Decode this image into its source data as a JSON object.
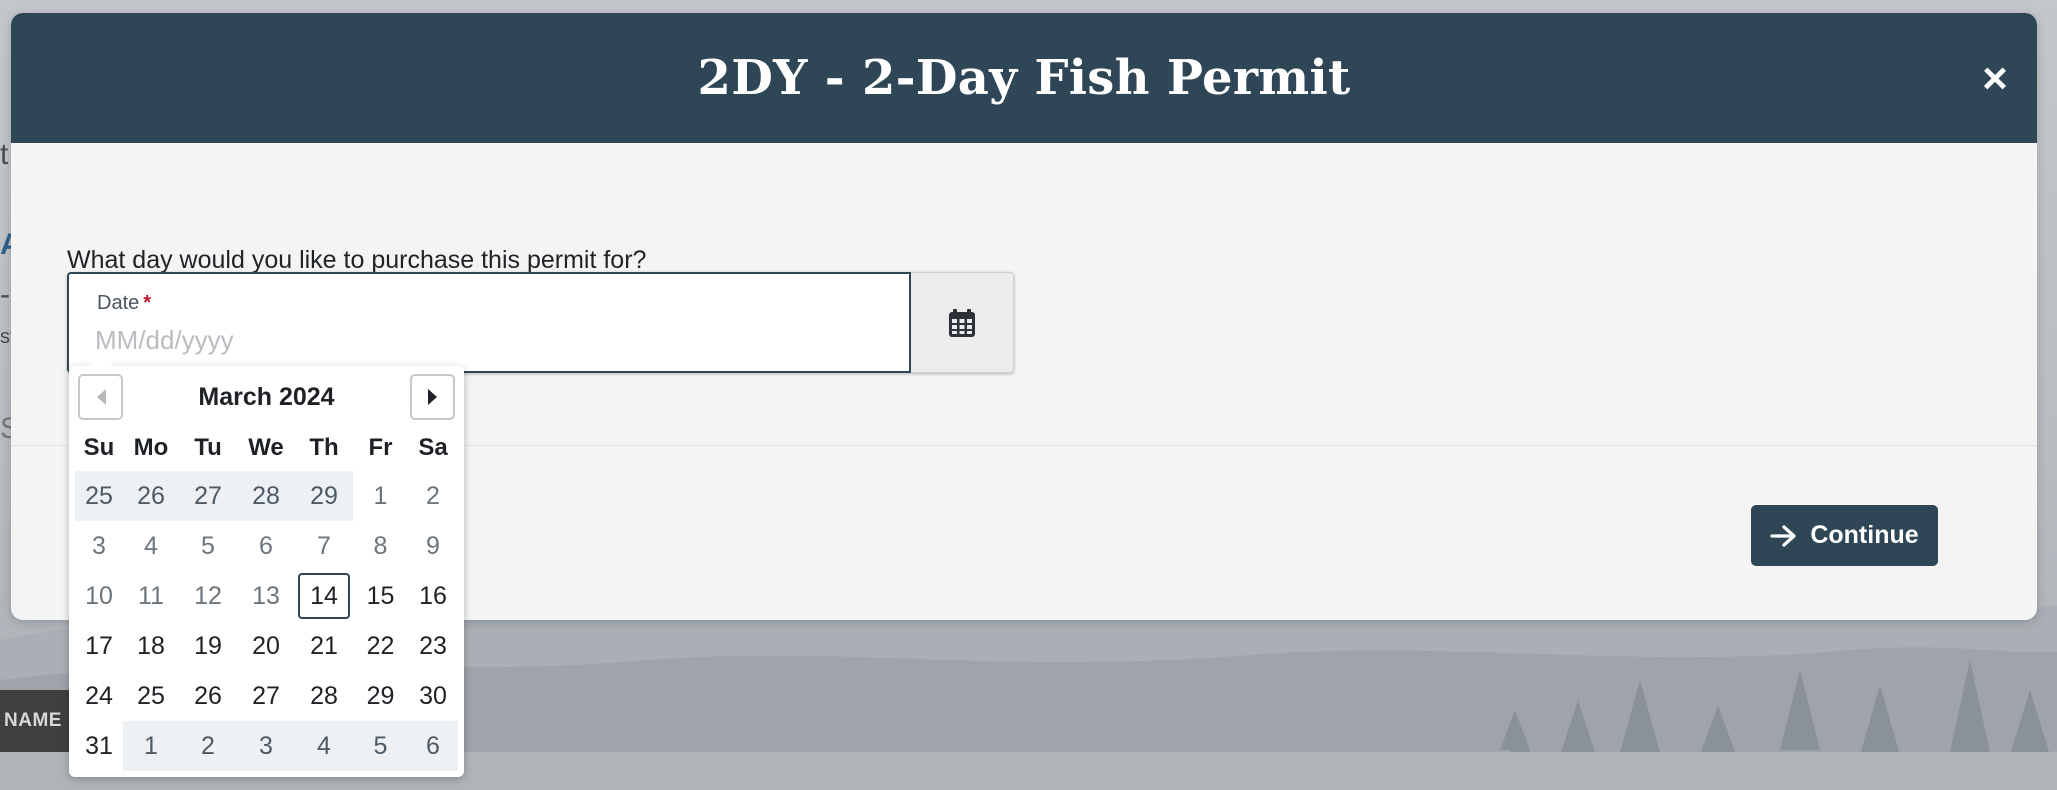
{
  "background": {
    "fragments": [
      "t",
      "A",
      "-",
      "st",
      "S",
      "s"
    ],
    "name_tab": "NAME"
  },
  "modal": {
    "title": "2DY - 2-Day Fish Permit",
    "close_label": "×",
    "question": "What day would you like to purchase this permit for?",
    "date_field": {
      "label": "Date",
      "required_marker": "*",
      "placeholder": "MM/dd/yyyy",
      "value": ""
    },
    "continue_label": "Continue"
  },
  "datepicker": {
    "month_label": "March 2024",
    "weekdays": [
      "Su",
      "Mo",
      "Tu",
      "We",
      "Th",
      "Fr",
      "Sa"
    ],
    "weeks": [
      [
        {
          "d": "25",
          "s": "out"
        },
        {
          "d": "26",
          "s": "out"
        },
        {
          "d": "27",
          "s": "out"
        },
        {
          "d": "28",
          "s": "out"
        },
        {
          "d": "29",
          "s": "out"
        },
        {
          "d": "1",
          "s": "muted"
        },
        {
          "d": "2",
          "s": "muted"
        }
      ],
      [
        {
          "d": "3",
          "s": "muted"
        },
        {
          "d": "4",
          "s": "muted"
        },
        {
          "d": "5",
          "s": "muted"
        },
        {
          "d": "6",
          "s": "muted"
        },
        {
          "d": "7",
          "s": "muted"
        },
        {
          "d": "8",
          "s": "muted"
        },
        {
          "d": "9",
          "s": "muted"
        }
      ],
      [
        {
          "d": "10",
          "s": "muted"
        },
        {
          "d": "11",
          "s": "muted"
        },
        {
          "d": "12",
          "s": "muted"
        },
        {
          "d": "13",
          "s": "muted"
        },
        {
          "d": "14",
          "s": "today"
        },
        {
          "d": "15",
          "s": "active"
        },
        {
          "d": "16",
          "s": "active"
        }
      ],
      [
        {
          "d": "17",
          "s": "active"
        },
        {
          "d": "18",
          "s": "active"
        },
        {
          "d": "19",
          "s": "active"
        },
        {
          "d": "20",
          "s": "active"
        },
        {
          "d": "21",
          "s": "active"
        },
        {
          "d": "22",
          "s": "active"
        },
        {
          "d": "23",
          "s": "active"
        }
      ],
      [
        {
          "d": "24",
          "s": "active"
        },
        {
          "d": "25",
          "s": "active"
        },
        {
          "d": "26",
          "s": "active"
        },
        {
          "d": "27",
          "s": "active"
        },
        {
          "d": "28",
          "s": "active"
        },
        {
          "d": "29",
          "s": "active"
        },
        {
          "d": "30",
          "s": "active"
        }
      ],
      [
        {
          "d": "31",
          "s": "active"
        },
        {
          "d": "1",
          "s": "out"
        },
        {
          "d": "2",
          "s": "out"
        },
        {
          "d": "3",
          "s": "out"
        },
        {
          "d": "4",
          "s": "out"
        },
        {
          "d": "5",
          "s": "out"
        },
        {
          "d": "6",
          "s": "out"
        }
      ]
    ],
    "icons": {
      "prev": "caret-left-icon",
      "next": "caret-right-icon"
    }
  },
  "colors": {
    "header_bg": "#2e4655",
    "accent": "#2e4655",
    "required": "#c0182a"
  }
}
